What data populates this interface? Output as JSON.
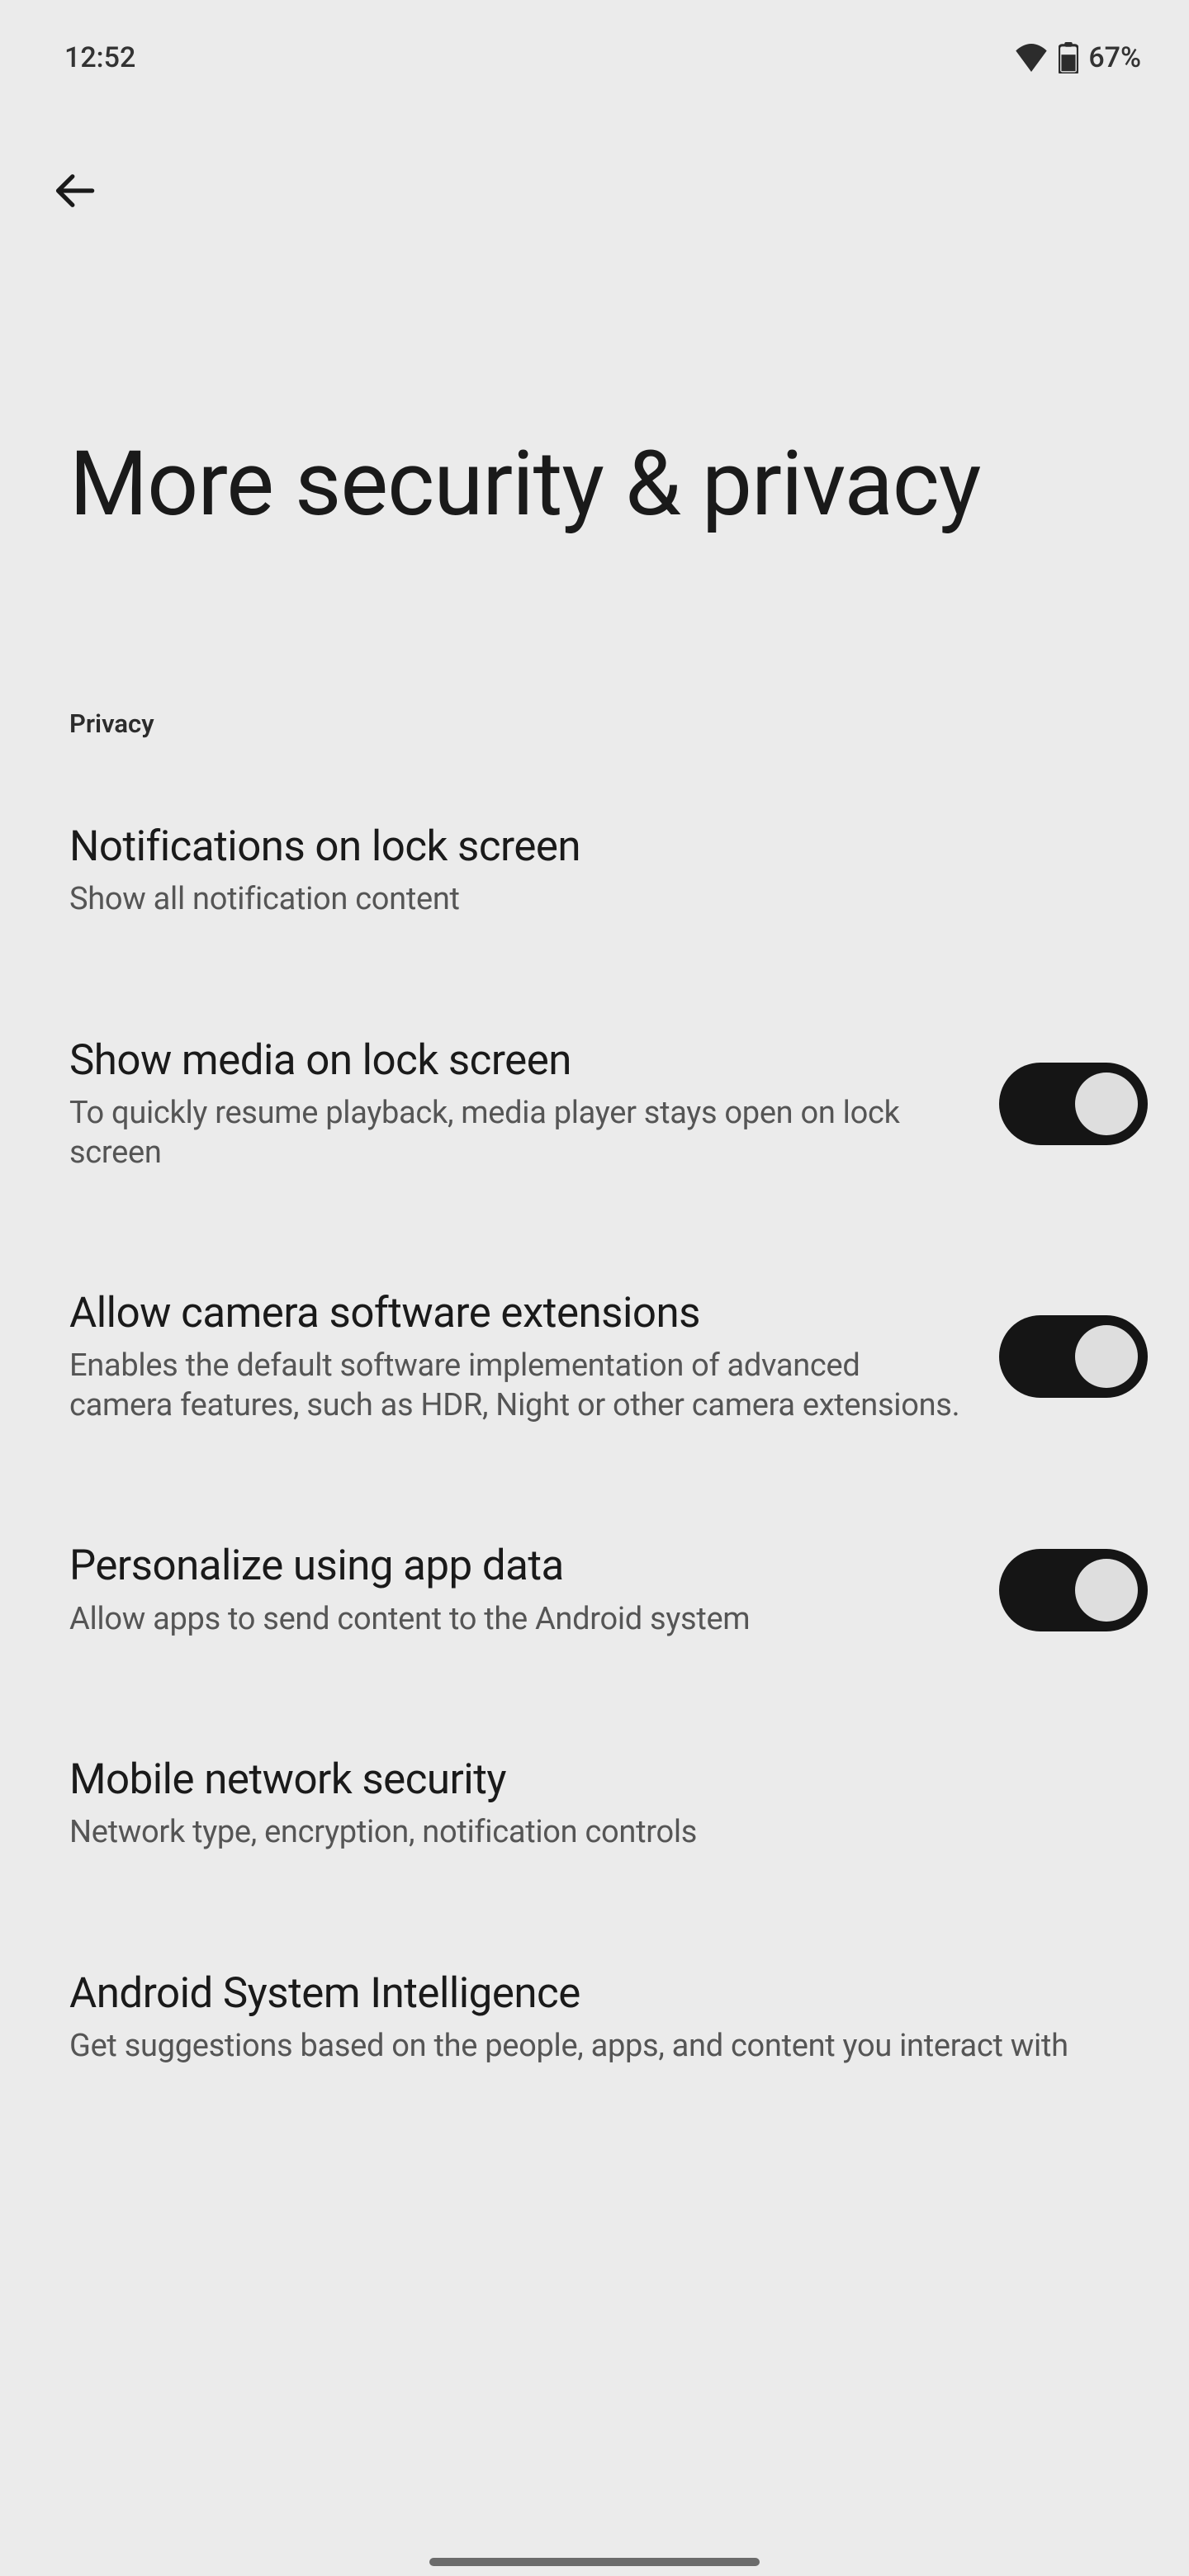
{
  "status": {
    "time": "12:52",
    "battery": "67%"
  },
  "page": {
    "title": "More security & privacy"
  },
  "section": {
    "privacy_header": "Privacy"
  },
  "items": {
    "notifications": {
      "title": "Notifications on lock screen",
      "sub": "Show all notification content"
    },
    "media": {
      "title": "Show media on lock screen",
      "sub": "To quickly resume playback, media player stays open on lock screen",
      "toggle": true
    },
    "camera_ext": {
      "title": "Allow camera software extensions",
      "sub": "Enables the default software implementation of advanced camera features, such as HDR, Night or other camera extensions.",
      "toggle": true
    },
    "personalize": {
      "title": "Personalize using app data",
      "sub": "Allow apps to send content to the Android system",
      "toggle": true
    },
    "mobile_net": {
      "title": "Mobile network security",
      "sub": "Network type, encryption, notification controls"
    },
    "asi": {
      "title": "Android System Intelligence",
      "sub": "Get suggestions based on the people, apps, and content you interact with"
    }
  }
}
